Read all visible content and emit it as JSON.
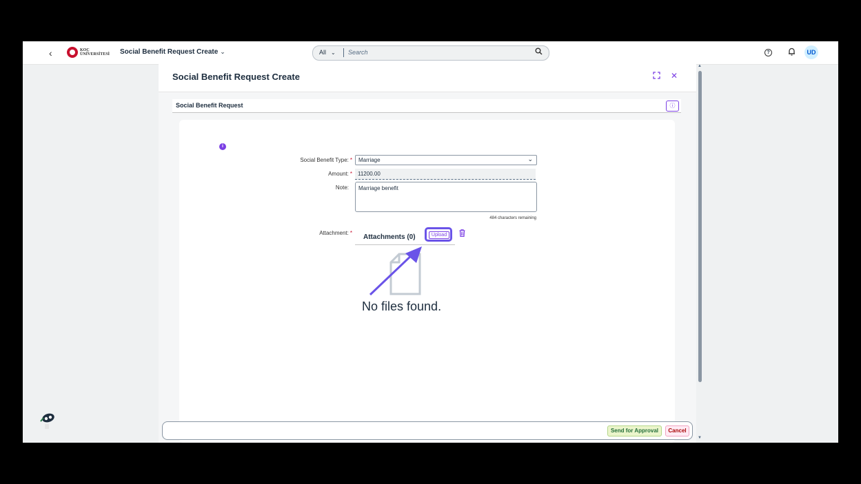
{
  "shell": {
    "back_icon": "‹",
    "logo_line1": "KOÇ",
    "logo_line2": "ÜNİVERSİTESİ",
    "app_title": "Social Benefit Request Create",
    "search_scope": "All",
    "search_placeholder": "Search",
    "help_icon": "?",
    "user_initials": "UD"
  },
  "dialog": {
    "title": "Social Benefit Request Create",
    "section_title": "Social Benefit Request"
  },
  "form": {
    "type_label": "Social Benefit Type:",
    "type_value": "Marriage",
    "amount_label": "Amount:",
    "amount_value": "11200.00",
    "note_label": "Note:",
    "note_value": "Marriage benefit",
    "chars_remaining": "484 characters remaining",
    "attachment_label": "Attachment:",
    "attachments_title": "Attachments (0)",
    "upload_label": "Upload",
    "no_files": "No files found."
  },
  "footer": {
    "send_label": "Send for Approval",
    "cancel_label": "Cancel"
  },
  "colors": {
    "accent": "#7b3fe4",
    "highlight": "#6a53e8",
    "required": "#c8102e"
  }
}
